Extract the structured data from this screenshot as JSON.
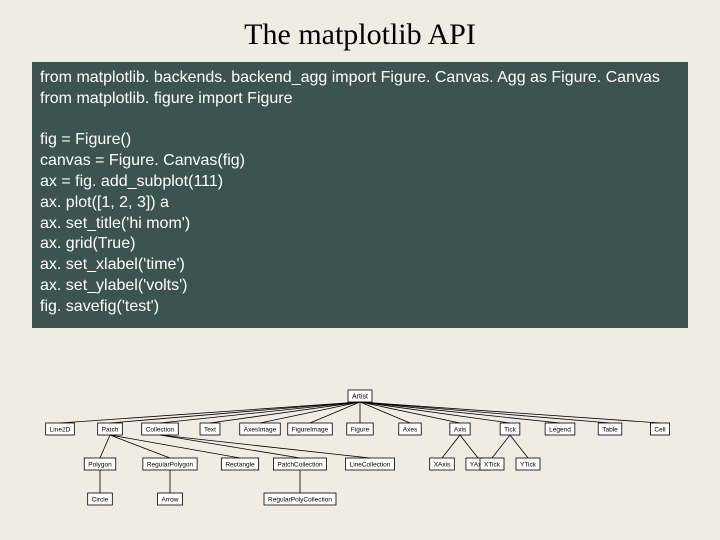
{
  "title": "The matplotlib API",
  "code": "from matplotlib. backends. backend_agg import Figure. Canvas. Agg as Figure. Canvas\nfrom matplotlib. figure import Figure\n\nfig = Figure()\ncanvas = Figure. Canvas(fig)\nax = fig. add_subplot(111)\nax. plot([1, 2, 3]) a\nax. set_title('hi mom')\nax. grid(True)\nax. set_xlabel('time')\nax. set_ylabel('volts')\nfig. savefig('test')",
  "diagram": {
    "root": "Artist",
    "level1": [
      "Line2D",
      "Patch",
      "Collection",
      "Text",
      "AxesImage",
      "FigureImage",
      "Figure",
      "Axes",
      "Axis",
      "Tick",
      "Legend",
      "Table",
      "Cell"
    ],
    "level2": [
      "Polygon",
      "RegularPolygon",
      "Rectangle",
      "PatchCollection",
      "LineCollection"
    ],
    "level3": [
      "Circle",
      "Arrow",
      "RegularPolyCollection"
    ],
    "axis_children": [
      "XAxis",
      "YAxis"
    ],
    "tick_children": [
      "XTick",
      "YTick"
    ]
  }
}
